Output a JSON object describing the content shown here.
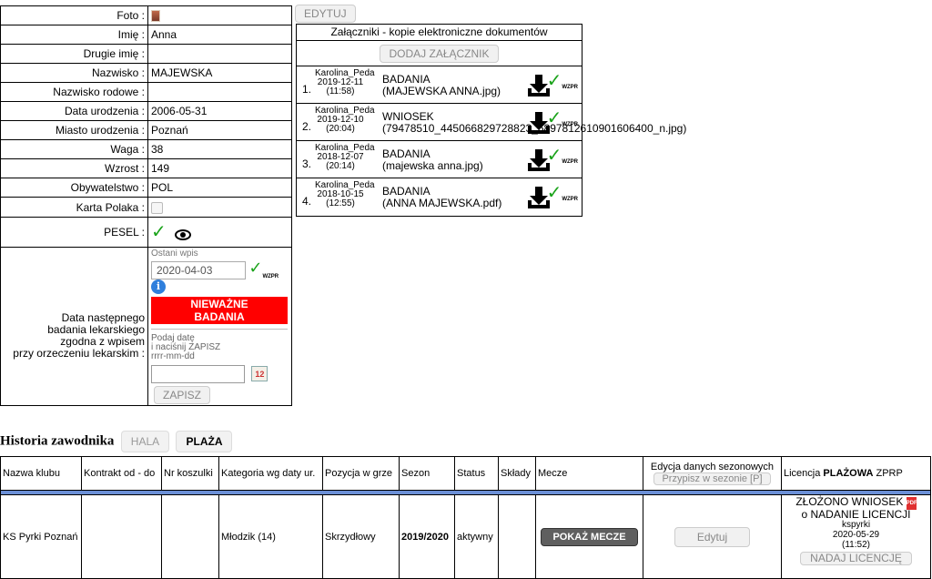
{
  "player": {
    "rows": [
      {
        "label": "Foto :",
        "value": ""
      },
      {
        "label": "Imię :",
        "value": "Anna"
      },
      {
        "label": "Drugie imię :",
        "value": ""
      },
      {
        "label": "Nazwisko :",
        "value": "MAJEWSKA"
      },
      {
        "label": "Nazwisko rodowe :",
        "value": ""
      },
      {
        "label": "Data urodzenia :",
        "value": "2006-05-31"
      },
      {
        "label": "Miasto urodzenia :",
        "value": "Poznań"
      },
      {
        "label": "Waga :",
        "value": "38"
      },
      {
        "label": "Wzrost :",
        "value": "149"
      },
      {
        "label": "Obywatelstwo :",
        "value": "POL"
      },
      {
        "label": "Karta Polaka :",
        "value": ""
      },
      {
        "label": "PESEL :",
        "value": ""
      }
    ],
    "exam": {
      "label_lines": [
        "Data następnego",
        "badania lekarskiego",
        "zgodna z wpisem",
        "przy orzeczeniu lekarskim :"
      ],
      "last_entry_label": "Ostani wpis",
      "last_entry_date": "2020-04-03",
      "status_line1": "NIEWAŻNE",
      "status_line2": "BADANIA",
      "hint_line1": "Podaj datę",
      "hint_line2": "i naciśnij ZAPISZ",
      "hint_line3": "rrrr-mm-dd",
      "date_placeholder": "",
      "save_label": "ZAPISZ",
      "wzpr": "WZPR",
      "info": "i"
    }
  },
  "edit_label": "EDYTUJ",
  "attachments": {
    "title": "Załączniki - kopie elektroniczne dokumentów",
    "add_label": "DODAJ ZAŁĄCZNIK",
    "items": [
      {
        "num": "1.",
        "user": "Karolina_Peda",
        "date": "2019-12-11",
        "time": "(11:58)",
        "type": "BADANIA",
        "file": "(MAJEWSKA ANNA.jpg)"
      },
      {
        "num": "2.",
        "user": "Karolina_Peda",
        "date": "2019-12-10",
        "time": "(20:04)",
        "type": "WNIOSEK",
        "file": "(79478510_445066829728823_6897812610901606400_n.jpg)"
      },
      {
        "num": "3.",
        "user": "Karolina_Peda",
        "date": "2018-12-07",
        "time": "(20:14)",
        "type": "BADANIA",
        "file": "(majewska anna.jpg)"
      },
      {
        "num": "4.",
        "user": "Karolina_Peda",
        "date": "2018-10-15",
        "time": "(12:55)",
        "type": "BADANIA",
        "file": "(ANNA MAJEWSKA.pdf)"
      }
    ],
    "wzpr": "WZPR"
  },
  "history": {
    "title": "Historia zawodnika",
    "tabs": [
      "HALA",
      "PLAŻA"
    ],
    "columns": [
      "Nazwa klubu",
      "Kontrakt od - do",
      "Nr koszulki",
      "Kategoria wg daty ur.",
      "Pozycja w grze",
      "Sezon",
      "Status",
      "Składy",
      "Mecze"
    ],
    "season_edit_title": "Edycja danych sezonowych",
    "assign_label": "Przypisz w sezonie [P]",
    "license_prefix": "Licencja ",
    "license_bold": "PLAŻOWA",
    "license_suffix": " ZPRP",
    "row": {
      "club": "KS Pyrki Poznań",
      "contract": "",
      "shirt": "",
      "category": "Młodzik (14)",
      "position": "Skrzydłowy",
      "season": "2019/2020",
      "status": "aktywny",
      "squads": "",
      "matches_btn": "POKAŻ MECZE",
      "edit_btn": "Edytuj",
      "lic_line1": "ZŁOŻONO WNIOSEK",
      "lic_line2": "o NADANIE LICENCJI",
      "lic_user": "kspyrki",
      "lic_date": "2020-05-29",
      "lic_time": "(11:52)",
      "lic_btn": "NADAJ LICENCJĘ",
      "pdf": "PDF"
    }
  },
  "colors": {
    "accent_bar": "#6b8fd6",
    "invalid": "#ff0000",
    "check": "#1aa31a"
  }
}
